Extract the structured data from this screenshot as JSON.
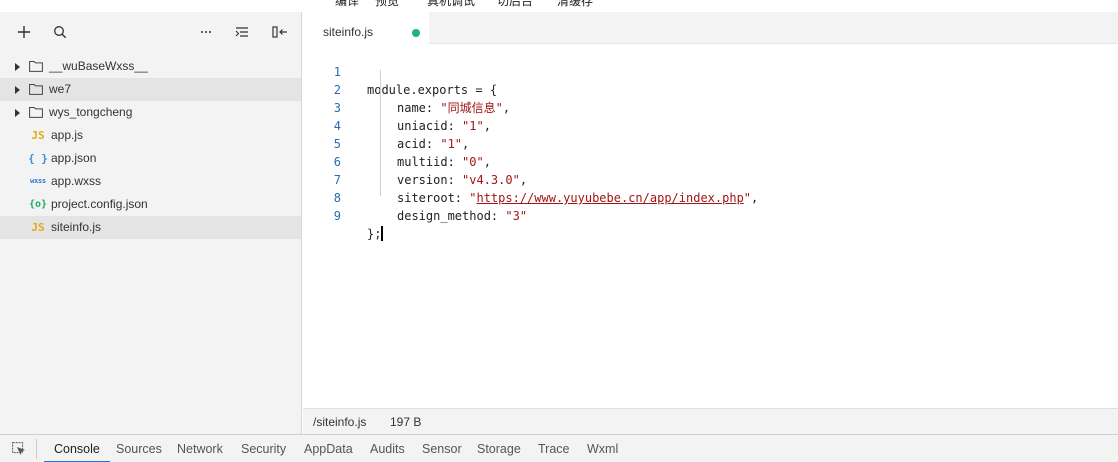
{
  "toolbar": {
    "compile": "编译",
    "preview": "预览",
    "remote_debug": "真机调试",
    "background": "切后台",
    "clear_cache": "清缓存"
  },
  "sidebar": {
    "tree": [
      {
        "type": "folder",
        "label": "__wuBaseWxss__",
        "icon": "folder-icon"
      },
      {
        "type": "folder",
        "label": "we7",
        "icon": "folder-icon"
      },
      {
        "type": "folder",
        "label": "wys_tongcheng",
        "icon": "folder-icon"
      },
      {
        "type": "file",
        "label": "app.js",
        "icon_text": "JS",
        "icon": "js-file-icon"
      },
      {
        "type": "file",
        "label": "app.json",
        "icon_text": "{ }",
        "icon": "json-file-icon"
      },
      {
        "type": "file",
        "label": "app.wxss",
        "icon_text": "wxss",
        "icon": "wxss-file-icon"
      },
      {
        "type": "file",
        "label": "project.config.json",
        "icon_text": "{o}",
        "icon": "config-file-icon"
      },
      {
        "type": "file",
        "label": "siteinfo.js",
        "icon_text": "JS",
        "icon": "js-file-icon"
      }
    ]
  },
  "editor": {
    "tab_label": "siteinfo.js",
    "line_numbers": [
      "1",
      "2",
      "3",
      "4",
      "5",
      "6",
      "7",
      "8",
      "9"
    ],
    "code": {
      "l1": "module.exports = {",
      "name_key": "name: ",
      "name_val": "\"同城信息\"",
      "uniacid_key": "uniacid: ",
      "uniacid_val": "\"1\"",
      "acid_key": "acid: ",
      "acid_val": "\"1\"",
      "multiid_key": "multiid: ",
      "multiid_val": "\"0\"",
      "version_key": "version: ",
      "version_val": "\"v4.3.0\"",
      "siteroot_key": "siteroot: ",
      "siteroot_q": "\"",
      "siteroot_url": "https://www.yuyubebe.cn/app/index.php",
      "design_key": "design_method: ",
      "design_val": "\"3\"",
      "comma": ",",
      "l9": "};"
    },
    "status": {
      "path": "/siteinfo.js",
      "size": "197 B"
    }
  },
  "devtools": {
    "tabs": [
      "Console",
      "Sources",
      "Network",
      "Security",
      "AppData",
      "Audits",
      "Sensor",
      "Storage",
      "Trace",
      "Wxml"
    ],
    "active_tab": "Console"
  },
  "colors": {
    "accent": "#1a73e8",
    "modified_dot": "#1fb37a",
    "string": "#a31515",
    "line_number": "#2b6cb0"
  }
}
